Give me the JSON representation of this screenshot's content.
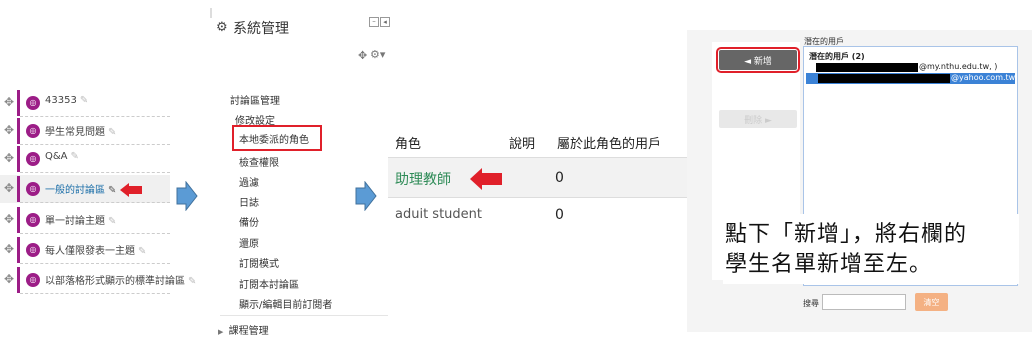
{
  "forum_list": {
    "items": [
      {
        "label": "43353"
      },
      {
        "label": "學生常見問題"
      },
      {
        "label": "Q&A"
      },
      {
        "label": "一般的討論區"
      },
      {
        "label": "單一討論主題"
      },
      {
        "label": "每人僅限發表一主題"
      },
      {
        "label": "以部落格形式顯示的標準討論區"
      }
    ]
  },
  "admin": {
    "title": "系統管理",
    "section": "討論區管理",
    "items": [
      {
        "label": "修改設定"
      },
      {
        "label": "本地委派的角色"
      },
      {
        "label": "檢查權限"
      },
      {
        "label": "過濾"
      },
      {
        "label": "日誌"
      },
      {
        "label": "備份"
      },
      {
        "label": "還原"
      },
      {
        "label": "訂閱模式"
      },
      {
        "label": "訂閱本討論區"
      },
      {
        "label": "顯示/編輯目前訂閱者"
      }
    ],
    "course_admin": "課程管理"
  },
  "roles_table": {
    "headers": [
      "角色",
      "說明",
      "屬於此角色的用戶"
    ],
    "rows": [
      {
        "role": "助理教師",
        "count": "0"
      },
      {
        "role": "aduit student",
        "count": "0"
      }
    ]
  },
  "user_selector": {
    "potential_header": "潛在的用戶",
    "potential_group": "潛在的用戶 (2)",
    "user1_suffix": "@my.nthu.edu.tw, )",
    "user2_suffix": "@yahoo.com.tw",
    "add_button": "◄ 新增",
    "remove_button": "刪除 ►",
    "search_label": "搜尋",
    "clear_button": "清空"
  },
  "instruction": {
    "line1": "點下「新增」，將右欄的",
    "line2": "學生名單新增至左。"
  },
  "colors": {
    "forum_purple": "#9c1d87",
    "highlight_red": "#e0202a",
    "arrow_blue": "#5b9bd5",
    "select_blue": "#3b82d6",
    "link_teal": "#2e8b57",
    "clear_orange": "#f4b183"
  }
}
